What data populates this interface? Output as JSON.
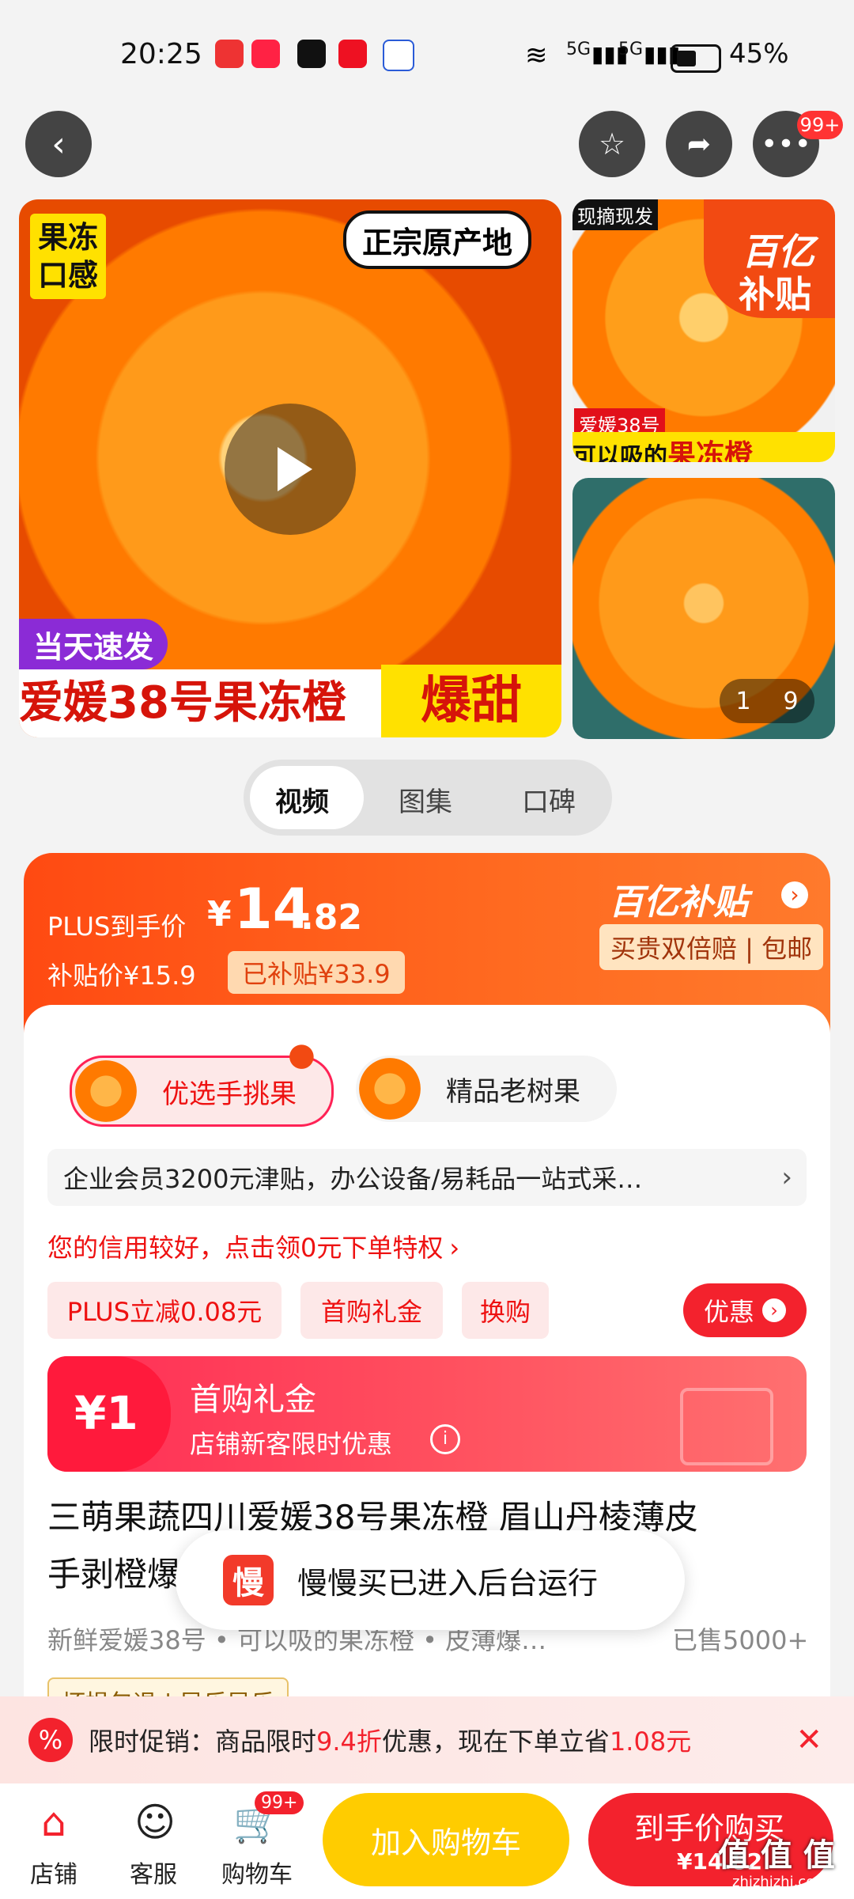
{
  "status": {
    "time": "20:25",
    "net1": "5G",
    "net2": "5G",
    "battery": "45%"
  },
  "header": {
    "badge": "99+"
  },
  "gallery": {
    "tag_left": "果冻\n口感",
    "tag_top_right": "正宗原产地",
    "tag_top_right_highlight": "原产地",
    "ribbon_fast": "当天速发",
    "banner_main": "爱媛38号果冻橙",
    "banner_hot": "爆甜",
    "side1_tag": "现摘现发",
    "side1_caption1": "爱媛38号",
    "side1_caption2": "可以吸的",
    "side1_caption3": "果冻橙",
    "subsidy_logo_1": "百亿",
    "subsidy_logo_2": "补贴",
    "page_index": "1",
    "page_total": "9"
  },
  "segment": {
    "tabs": [
      "视频",
      "图集",
      "口碑"
    ]
  },
  "price": {
    "plus_label": "PLUS到手价",
    "currency": "¥",
    "amount_int": "14",
    "amount_dec": ".82",
    "subsidy_price_label": "补贴价¥15.9",
    "subsidy_saved": "已补贴¥33.9",
    "brand": "百亿补贴",
    "guarantee": "买贵双倍赔 | 包邮"
  },
  "options": {
    "chip1": "优选手挑果",
    "chip2": "精品老树果"
  },
  "enterprise_row": "企业会员3200元津贴，办公设备/易耗品一站式采…",
  "credit_row": "您的信用较好，点击领0元下单特权",
  "tags": [
    "PLUS立减0.08元",
    "首购礼金",
    "换购"
  ],
  "discount_btn": "优惠",
  "gift": {
    "amount": "¥1",
    "title": "首购礼金",
    "subtitle": "店铺新客限时优惠"
  },
  "product": {
    "title_line1": "三萌果蔬四川爱媛38号果冻橙 眉山丹棱薄皮",
    "title_line2": "手剥橙爆甜柑橘新鲜水果当社",
    "sub": "新鲜爱媛38号 • 可以吸的果冻橙 • 皮薄爆…",
    "sold": "已售5000+",
    "extra_tags": "坏损包退 | 异乐异乐"
  },
  "toast": {
    "logo_text": "慢",
    "text": "慢慢买已进入后台运行"
  },
  "promo": {
    "prefix": "限时促销：商品限时",
    "discount": "9.4折",
    "middle": "优惠，现在下单立省",
    "save": "1.08元"
  },
  "bottom": {
    "shop": "店铺",
    "service": "客服",
    "cart": "购物车",
    "cart_badge": "99+",
    "add_cart": "加入购物车",
    "buy_title": "到手价购买",
    "buy_price": "¥14.82",
    "watermark": "值 值 值",
    "watermark_url": "zhizhizhi.com"
  },
  "colors": {
    "accent": "#f3222d",
    "orange": "#ff5a14",
    "yellow": "#ffcc00"
  }
}
